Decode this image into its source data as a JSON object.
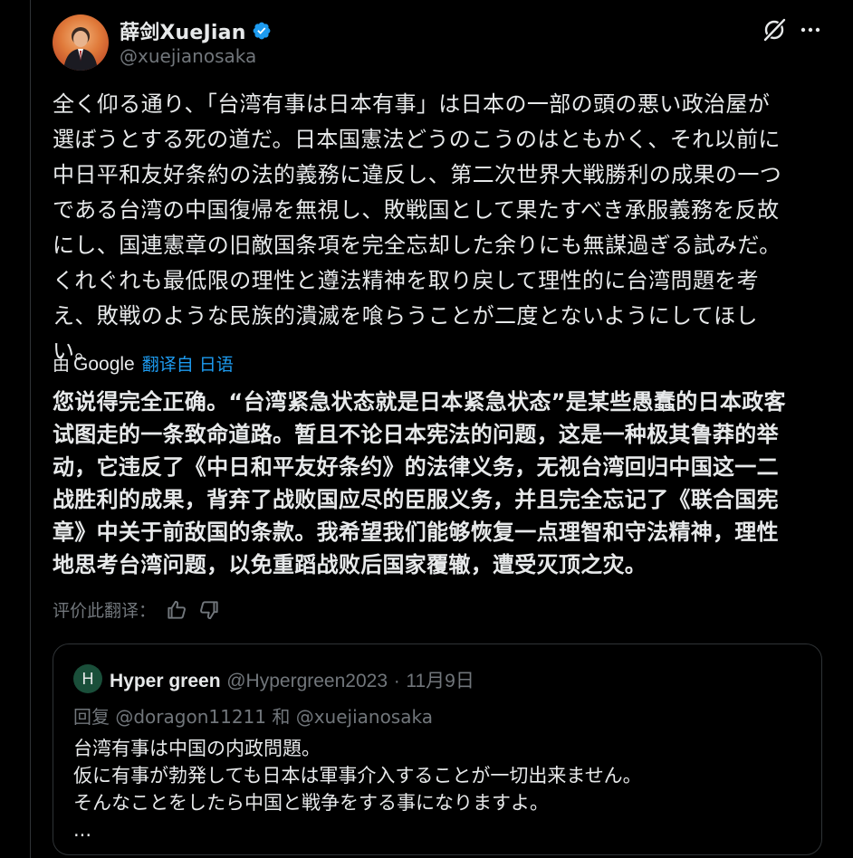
{
  "author": {
    "display_name": "薛剑XueJian",
    "handle": "@xuejianosaka",
    "verified": true
  },
  "tweet": {
    "text": "全く仰る通り、「台湾有事は日本有事」は日本の一部の頭の悪い政治屋が\n選ぼうとする死の道だ。日本国憲法どうのこうのはともかく、それ以前に\n中日平和友好条約の法的義務に違反し、第二次世界大戦勝利の成果の一つ\nである台湾の中国復帰を無視し、敗戦国として果たすべき承服義務を反故\nにし、国連憲章の旧敵国条項を完全忘却した余りにも無謀過ぎる試みだ。\nくれぐれも最低限の理性と遵法精神を取り戻して理性的に台湾問題を考\nえ、敗戦のような民族的潰滅を喰らうことが二度とないようにしてほし\nい。"
  },
  "translation": {
    "by_label": "由",
    "brand": "Google",
    "link_label": "翻译自 日语",
    "text": "您说得完全正确。“台湾紧急状态就是日本紧急状态”是某些愚蠢的日本政客\n试图走的一条致命道路。暂且不论日本宪法的问题，这是一种极其鲁莽的举\n动，它违反了《中日和平友好条约》的法律义务，无视台湾回归中国这一二\n战胜利的成果，背弃了战败国应尽的臣服义务，并且完全忘记了《联合国宪\n章》中关于前敌国的条款。我希望我们能够恢复一点理智和守法精神，理性\n地思考台湾问题，以免重蹈战败后国家覆辙，遭受灭顶之灾。",
    "rate_label": "评价此翻译："
  },
  "quote": {
    "avatar_letter": "H",
    "name": "Hyper green",
    "handle": "@Hypergreen2023",
    "dot": "·",
    "date": "11月9日",
    "reply_line": "回复 @doragon11211 和 @xuejianosaka",
    "text": "台湾有事は中国の内政問題。\n仮に有事が勃発しても日本は軍事介入することが一切出来ません。\nそんなことをしたら中国と戦争をする事になりますよ。\n..."
  },
  "icons": {
    "verified": "verified-badge-icon",
    "grok": "grok-icon",
    "more": "more-icon",
    "thumbs_up": "thumbs-up-icon",
    "thumbs_down": "thumbs-down-icon"
  },
  "colors": {
    "background": "#000000",
    "text": "#e7e9ea",
    "muted": "#71767b",
    "accent": "#1d9bf0",
    "border": "#2f3336"
  }
}
